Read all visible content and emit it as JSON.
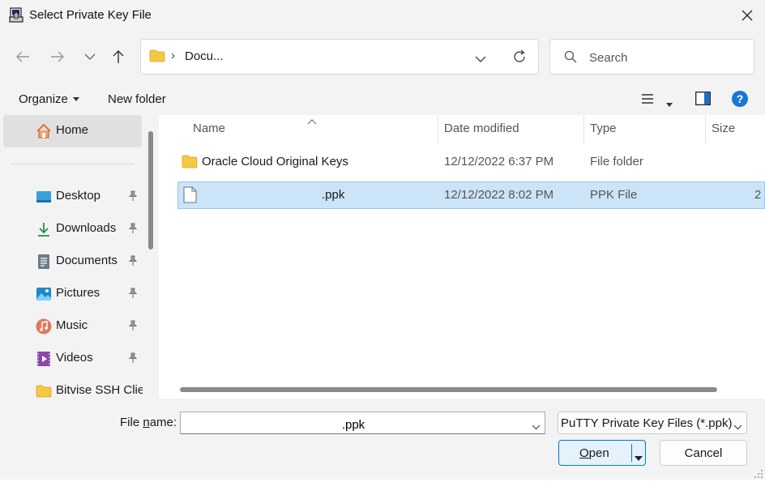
{
  "window": {
    "title": "Select Private Key File"
  },
  "address": {
    "chevron": "›",
    "path": "Docu..."
  },
  "search": {
    "placeholder": "Search"
  },
  "toolbar": {
    "organize": "Organize",
    "new_folder": "New folder"
  },
  "sidebar": {
    "home": "Home",
    "items": [
      {
        "label": "Desktop",
        "icon": "desktop-icon"
      },
      {
        "label": "Downloads",
        "icon": "download-icon"
      },
      {
        "label": "Documents",
        "icon": "documents-icon"
      },
      {
        "label": "Pictures",
        "icon": "pictures-icon"
      },
      {
        "label": "Music",
        "icon": "music-icon"
      },
      {
        "label": "Videos",
        "icon": "videos-icon"
      },
      {
        "label": "Bitvise SSH Clien",
        "icon": "folder-icon"
      }
    ]
  },
  "columns": {
    "name": "Name",
    "date": "Date modified",
    "type": "Type",
    "size": "Size"
  },
  "files": [
    {
      "name": "Oracle Cloud Original Keys",
      "date": "12/12/2022 6:37 PM",
      "type": "File folder",
      "size": "",
      "selected": false
    },
    {
      "name": ".ppk",
      "date": "12/12/2022 8:02 PM",
      "type": "PPK File",
      "size": "2",
      "selected": true
    }
  ],
  "bottom": {
    "filename_label_pre": "File ",
    "filename_label_u": "n",
    "filename_label_post": "ame:",
    "filename_value": ".ppk",
    "filetype": "PuTTY Private Key Files (*.ppk)",
    "open_u": "O",
    "open_rest": "pen",
    "cancel": "Cancel"
  },
  "colors": {
    "selection": "#cce4f7",
    "accent": "#0078d4",
    "help": "#1976d2",
    "folder": "#f6c744"
  }
}
